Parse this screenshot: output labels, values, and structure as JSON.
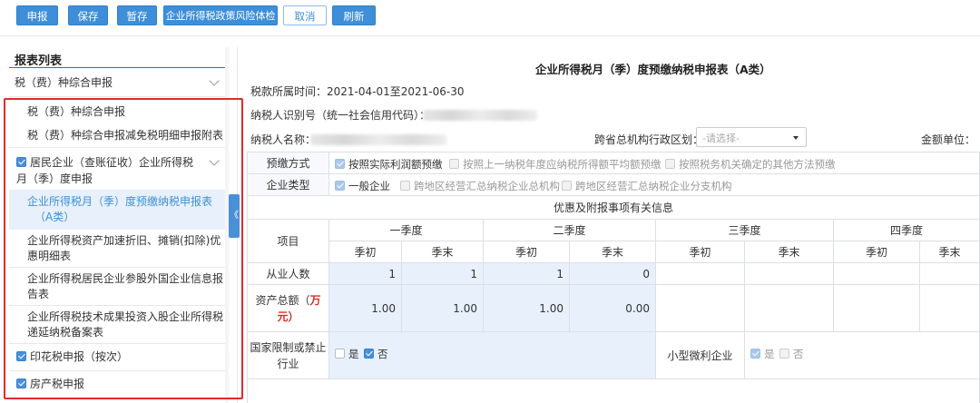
{
  "toolbar": {
    "declare": "申报",
    "save": "保存",
    "draft": "暂存",
    "risk_check": "企业所得税政策风险体检",
    "cancel": "取消",
    "refresh": "刷新"
  },
  "sidebar": {
    "title": "报表列表",
    "group1": {
      "label": "税（费）种综合申报",
      "items": [
        "税（费）种综合申报",
        "税（费）种综合申报减免税明细申报附表"
      ]
    },
    "group2": {
      "label_line1": "居民企业（查账征收）企业所得税",
      "label_line2": "月（季）度申报",
      "items": [
        {
          "line1": "企业所得税月（季）度预缴纳税申报表",
          "line2": "（A类）"
        },
        {
          "line1": "企业所得税资产加速折旧、摊销(扣除)优",
          "line2": "惠明细表"
        },
        {
          "line1": "企业所得税居民企业参股外国企业信息报",
          "line2": "告表"
        },
        {
          "line1": "企业所得税技术成果投资入股企业所得税",
          "line2": "递延纳税备案表"
        }
      ]
    },
    "group3": {
      "label": "印花税申报（按次）"
    },
    "group4": {
      "label": "房产税申报"
    },
    "collapse_glyph": "《"
  },
  "form": {
    "title": "企业所得税月（季）度预缴纳税申报表（A类）",
    "period_label": "税款所属时间：",
    "period_value": "2021-04-01至2021-06-30",
    "taxpayer_id_label": "纳税人识别号（统一社会信用代码）：",
    "taxpayer_name_label": "纳税人名称：",
    "region_label": "跨省总机构行政区划：",
    "region_placeholder": "-请选择-",
    "amount_unit_label": "金额单位：",
    "prepay_label": "预缴方式",
    "prepay_options": [
      "按照实际利润额预缴",
      "按照上一纳税年度应纳税所得额平均额预缴",
      "按照税务机关确定的其他方法预缴"
    ],
    "company_type_label": "企业类型",
    "company_type_options": [
      "一般企业",
      "跨地区经营汇总纳税企业总机构",
      "跨地区经营汇总纳税企业分支机构"
    ],
    "section_title": "优惠及附报事项有关信息",
    "col_item": "项目",
    "quarters": [
      "一季度",
      "二季度",
      "三季度",
      "四季度"
    ],
    "q_start": "季初",
    "q_end": "季末",
    "row_employees": "从业人数",
    "employees": [
      "1",
      "1",
      "1",
      "0"
    ],
    "row_assets_a": "资产总额（",
    "row_assets_b": "万",
    "row_assets_c": "元）",
    "assets": [
      "1.00",
      "1.00",
      "1.00",
      "0.00"
    ],
    "row_restricted_a": "国家限制或禁止",
    "row_restricted_b": "行业",
    "yes": "是",
    "no": "否",
    "small_micro_label": "小型微利企业"
  }
}
